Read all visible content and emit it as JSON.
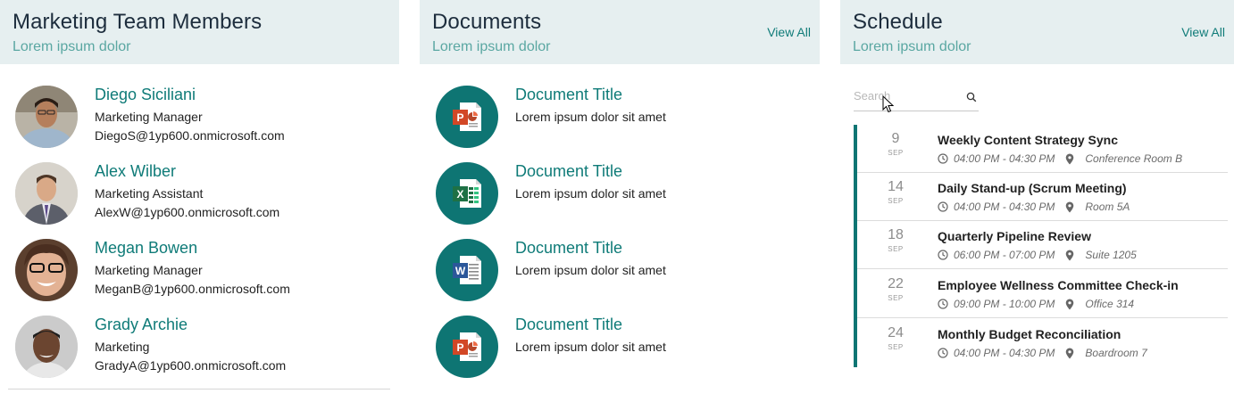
{
  "members_panel": {
    "title": "Marketing Team Members",
    "subtitle": "Lorem ipsum dolor",
    "members": [
      {
        "name": "Diego Siciliani",
        "role": "Marketing Manager",
        "email": "DiegoS@1yp600.onmicrosoft.com"
      },
      {
        "name": "Alex Wilber",
        "role": "Marketing Assistant",
        "email": "AlexW@1yp600.onmicrosoft.com"
      },
      {
        "name": "Megan Bowen",
        "role": "Marketing Manager",
        "email": "MeganB@1yp600.onmicrosoft.com"
      },
      {
        "name": "Grady Archie",
        "role": "Marketing",
        "email": "GradyA@1yp600.onmicrosoft.com"
      }
    ]
  },
  "documents_panel": {
    "title": "Documents",
    "subtitle": "Lorem ipsum dolor",
    "view_all": "View All",
    "documents": [
      {
        "title": "Document Title",
        "description": "Lorem ipsum dolor sit amet",
        "icon": "powerpoint-icon",
        "letter": "P",
        "color": "#d24726"
      },
      {
        "title": "Document Title",
        "description": "Lorem ipsum dolor sit amet",
        "icon": "excel-icon",
        "letter": "X",
        "color": "#1e7145"
      },
      {
        "title": "Document Title",
        "description": "Lorem ipsum dolor sit amet",
        "icon": "word-icon",
        "letter": "W",
        "color": "#2b579a"
      },
      {
        "title": "Document Title",
        "description": "Lorem ipsum dolor sit amet",
        "icon": "powerpoint-icon",
        "letter": "P",
        "color": "#d24726"
      }
    ]
  },
  "schedule_panel": {
    "title": "Schedule",
    "subtitle": "Lorem ipsum dolor",
    "view_all": "View All",
    "search": {
      "placeholder": "Search",
      "value": ""
    },
    "events": [
      {
        "day": "9",
        "month": "SEP",
        "title": "Weekly Content Strategy Sync",
        "time": "04:00 PM - 04:30 PM",
        "location": "Conference Room B"
      },
      {
        "day": "14",
        "month": "SEP",
        "title": "Daily Stand-up (Scrum Meeting)",
        "time": "04:00 PM - 04:30 PM",
        "location": "Room 5A"
      },
      {
        "day": "18",
        "month": "SEP",
        "title": "Quarterly Pipeline Review",
        "time": "06:00 PM - 07:00 PM",
        "location": "Suite 1205"
      },
      {
        "day": "22",
        "month": "SEP",
        "title": "Employee Wellness Committee Check-in",
        "time": "09:00 PM - 10:00 PM",
        "location": "Office 314"
      },
      {
        "day": "24",
        "month": "SEP",
        "title": "Monthly Budget Reconciliation",
        "time": "04:00 PM - 04:30 PM",
        "location": "Boardroom 7"
      }
    ]
  },
  "colors": {
    "accent": "#0f7b78",
    "header_bg": "#e6eff0",
    "subtitle": "#5aa7a2",
    "icon_circle": "#0e7573"
  }
}
